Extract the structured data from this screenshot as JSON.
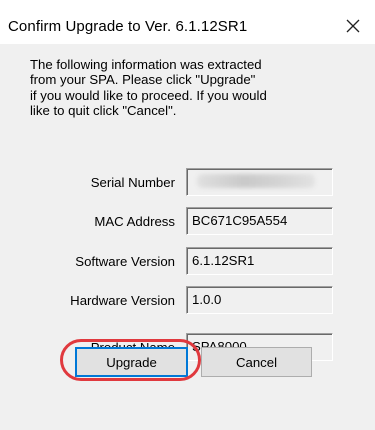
{
  "window": {
    "title": "Confirm Upgrade to Ver. 6.1.12SR1",
    "close_icon": "close-icon"
  },
  "message": {
    "lines": [
      "The following information was extracted",
      "from your SPA. Please click \"Upgrade\"",
      "if you would like to proceed. If you would",
      "like to quit click \"Cancel\"."
    ]
  },
  "fields": {
    "serial_number": {
      "label": "Serial Number",
      "value": ""
    },
    "mac_address": {
      "label": "MAC Address",
      "value": "BC671C95A554"
    },
    "software_version": {
      "label": "Software Version",
      "value": "6.1.12SR1"
    },
    "hardware_version": {
      "label": "Hardware Version",
      "value": "1.0.0"
    },
    "product_name": {
      "label": "Product Name",
      "value": "SPA8000"
    }
  },
  "buttons": {
    "upgrade_label": "Upgrade",
    "cancel_label": "Cancel"
  },
  "colors": {
    "dialog_background": "#f0f0f0",
    "highlight_ring": "#e0393e",
    "focus_border": "#0078d7"
  }
}
